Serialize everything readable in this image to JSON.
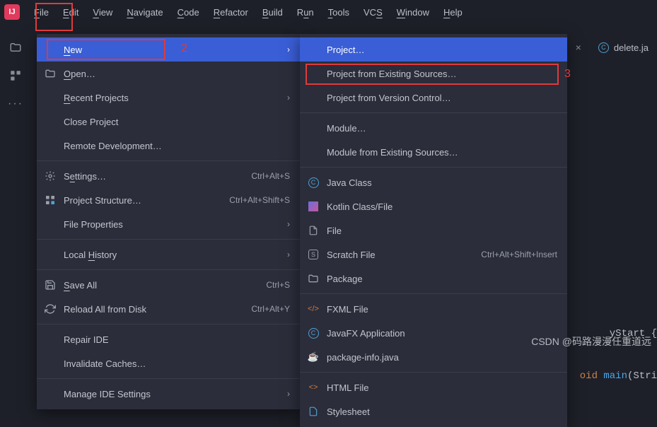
{
  "menubar": [
    {
      "key": "F",
      "rest": "ile"
    },
    {
      "key": "E",
      "rest": "dit"
    },
    {
      "key": "V",
      "rest": "iew"
    },
    {
      "key": "N",
      "rest": "avigate"
    },
    {
      "key": "C",
      "rest": "ode"
    },
    {
      "key": "R",
      "rest": "efactor"
    },
    {
      "key": "B",
      "rest": "uild"
    },
    {
      "key": "",
      "rest": "R",
      "key2": "u",
      "rest2": "n"
    },
    {
      "key": "T",
      "rest": "ools"
    },
    {
      "key": "",
      "rest": "VC",
      "key2": "S",
      "rest2": ""
    },
    {
      "key": "W",
      "rest": "indow"
    },
    {
      "key": "H",
      "rest": "elp"
    }
  ],
  "tabs": {
    "closed_x": "×",
    "delete": "delete.ja"
  },
  "file_menu": {
    "new": "New",
    "open": "Open…",
    "recent": "Recent Projects",
    "close": "Close Project",
    "remote": "Remote Development…",
    "settings": "Settings…",
    "settings_sc": "Ctrl+Alt+S",
    "structure": "Project Structure…",
    "structure_sc": "Ctrl+Alt+Shift+S",
    "fileprops": "File Properties",
    "history": "Local History",
    "save": "Save All",
    "save_sc": "Ctrl+S",
    "reload": "Reload All from Disk",
    "reload_sc": "Ctrl+Alt+Y",
    "repair": "Repair IDE",
    "invalidate": "Invalidate Caches…",
    "manage": "Manage IDE Settings"
  },
  "new_menu": {
    "project": "Project…",
    "existing": "Project from Existing Sources…",
    "vcs": "Project from Version Control…",
    "module": "Module…",
    "module_ex": "Module from Existing Sources…",
    "java": "Java Class",
    "kotlin": "Kotlin Class/File",
    "file": "File",
    "scratch": "Scratch File",
    "scratch_sc": "Ctrl+Alt+Shift+Insert",
    "package": "Package",
    "fxml": "FXML File",
    "javafx": "JavaFX Application",
    "pkginfo": "package-info.java",
    "html": "HTML File",
    "stylesheet": "Stylesheet"
  },
  "code_snip": {
    "line1a": "yStart {",
    "line2a": "oid ",
    "line2b": "main",
    "line2c": "(Stri"
  },
  "watermark": "CSDN @码路漫漫任重道远",
  "annot": {
    "n2": "2",
    "n3": "3"
  }
}
